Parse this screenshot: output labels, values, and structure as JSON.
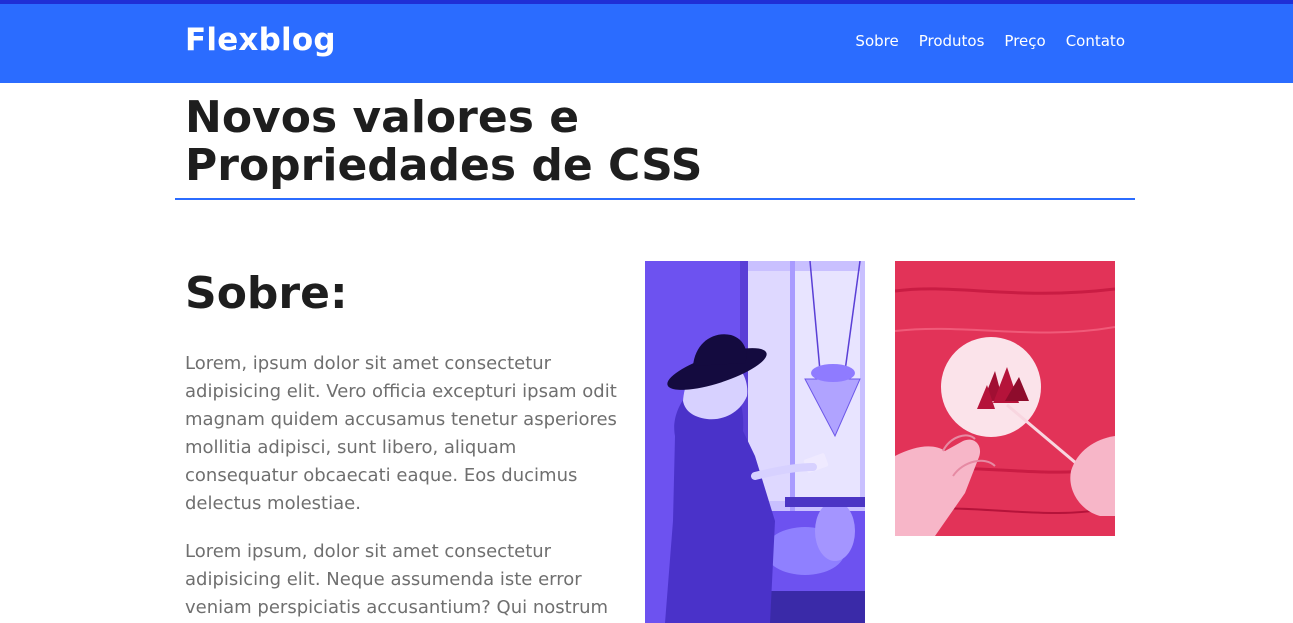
{
  "header": {
    "logo": "Flexblog",
    "nav": [
      "Sobre",
      "Produtos",
      "Preço",
      "Contato"
    ]
  },
  "page": {
    "title": "Novos valores e Propriedades de CSS"
  },
  "about": {
    "heading": "Sobre:",
    "paragraphs": [
      "Lorem, ipsum dolor sit amet consectetur adipisicing elit. Vero officia excepturi ipsam odit magnam quidem accusamus tenetur asperiores mollitia adipisci, sunt libero, aliquam consequatur obcaecati eaque. Eos ducimus delectus molestiae.",
      "Lorem ipsum, dolor sit amet consectetur adipisicing elit. Neque assumenda iste error veniam perspiciatis accusantium? Qui nostrum"
    ]
  },
  "colors": {
    "header": "#2b6cff",
    "header_strip": "#1f2fd6",
    "title_rule": "#2b6cff",
    "photo_tint_purple": "#6b4ff2",
    "photo_tint_red": "#d61f45"
  }
}
